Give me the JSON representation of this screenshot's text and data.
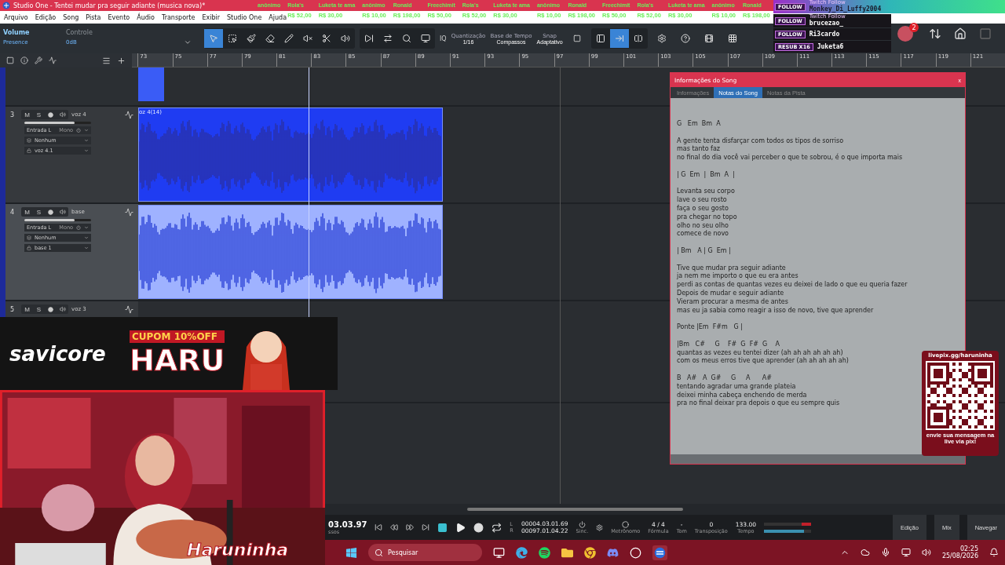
{
  "window": {
    "title": "Studio One - Tentei mudar pra seguir adiante (musica nova)*"
  },
  "menu": [
    "Arquivo",
    "Edição",
    "Song",
    "Pista",
    "Evento",
    "Áudio",
    "Transporte",
    "Exibir",
    "Studio One",
    "Ajuda"
  ],
  "donation_ticker": [
    {
      "name": "anônimo"
    },
    {
      "name": "Rola's",
      "amount": "R$ 52,00"
    },
    {
      "name": "Luketa te ama",
      "amount": "R$ 30,00"
    },
    {
      "name": "anônimo",
      "amount": "R$ 10,00"
    },
    {
      "name": "Ronald",
      "amount": "R$ 198,00"
    },
    {
      "name": "Freechimit",
      "amount": "R$ 50,00"
    },
    {
      "name": "Rola's",
      "amount": "R$ 52,00"
    },
    {
      "name": "Luketa te ama",
      "amount": "R$ 30,00"
    },
    {
      "name": "anônimo",
      "amount": "R$ 10,00"
    },
    {
      "name": "Ronald",
      "amount": "R$ 198,00"
    },
    {
      "name": "Freechimit",
      "amount": "R$ 50,00"
    },
    {
      "name": "Rola's",
      "amount": "R$ 52,00"
    },
    {
      "name": "Luketa te ama",
      "amount": "R$ 30,00"
    },
    {
      "name": "anônimo",
      "amount": "R$ 10,00"
    },
    {
      "name": "Ronald",
      "amount": "R$ 198,00"
    }
  ],
  "follow_alerts": [
    {
      "badge": "FOLLOW",
      "source": "Twitch Follow",
      "user": "Monkey_Di_Luffy2004"
    },
    {
      "badge": "FOLLOW",
      "source": "Twitch Follow",
      "user": "brucezao_"
    },
    {
      "badge": "FOLLOW",
      "user": "Ri3cardo"
    },
    {
      "badge": "RESUB X16",
      "user": "Juketa6"
    }
  ],
  "inspector": {
    "title": "Volume",
    "preset": "Presence",
    "control_label": "Controle",
    "gain": "0dB"
  },
  "edit_tools": [
    {
      "kind": "arrow",
      "selected": true
    },
    {
      "kind": "range",
      "selected": false
    },
    {
      "kind": "paint",
      "selected": false
    },
    {
      "kind": "eraser",
      "selected": false
    },
    {
      "kind": "pencil",
      "selected": false
    },
    {
      "kind": "mute",
      "selected": false
    },
    {
      "kind": "split",
      "selected": false
    },
    {
      "kind": "listen",
      "selected": false
    }
  ],
  "quantize": {
    "iq": "IQ",
    "label": "Quantização",
    "value": "1/16"
  },
  "timebase": {
    "label": "Base de Tempo",
    "value": "Compassos"
  },
  "snap": {
    "label": "Snap",
    "value": "Adaptativo"
  },
  "view_buttons": [
    {
      "kind": "left",
      "selected": false
    },
    {
      "kind": "follow",
      "selected": true
    },
    {
      "kind": "center",
      "selected": false
    }
  ],
  "notifications": "2",
  "ruler": [
    "73",
    "75",
    "77",
    "79",
    "81",
    "83",
    "85",
    "87",
    "89",
    "91",
    "93",
    "95",
    "97",
    "99",
    "101",
    "103",
    "105",
    "107",
    "109",
    "111",
    "113",
    "115",
    "117",
    "119",
    "121"
  ],
  "tracks": [
    {
      "number": "3",
      "name": "voz 4",
      "input": "Entrada L",
      "mode": "Mono",
      "output": "Nenhum",
      "channel": "voz 4.1",
      "mute": "M",
      "solo": "S",
      "selected": false,
      "clip": "oz 4(14)"
    },
    {
      "number": "4",
      "name": "base",
      "input": "Entrada L",
      "mode": "Mono",
      "output": "Nenhum",
      "channel": "base 1",
      "mute": "M",
      "solo": "S",
      "selected": true
    },
    {
      "number": "5",
      "name": "voz 3",
      "mute": "M",
      "solo": "S",
      "selected": false
    }
  ],
  "song_info": {
    "title": "Informações do Song",
    "close": "x",
    "tabs": [
      {
        "label": "Informações",
        "selected": false
      },
      {
        "label": "Notas do Song",
        "selected": true
      },
      {
        "label": "Notas da Pista",
        "selected": false
      }
    ],
    "notes": [
      [
        "G   Em  Bm  A"
      ],
      [
        "A gente tenta disfarçar com todos os tipos de sorriso",
        "mas tanto faz",
        "no final do dia você vai perceber o que te sobrou, é o que importa mais"
      ],
      [
        "| G  Em  |  Bm  A  |"
      ],
      [
        "Levanta seu corpo",
        "lave o seu rosto",
        "faça o seu gosto",
        "pra chegar no topo",
        "olho no seu olho",
        "comece de novo"
      ],
      [
        "| Bm   A | G  Em |"
      ],
      [
        "Tive que mudar pra seguir adiante",
        "ja nem me importo o que eu era antes",
        "perdi as contas de quantas vezes eu deixei de lado o que eu queria fazer",
        "Depois de mudar e seguir adiante",
        "Vieram procurar a mesma de antes",
        "mas eu ja sabia como reagir a isso de novo, tive que aprender"
      ],
      [
        "Ponte |Em  F#m   G |"
      ],
      [
        "|Bm   C#     G    F#  G  F#  G    A",
        "quantas as vezes eu tentei dizer (ah ah ah ah ah ah)",
        "com os meus erros tive que aprender (ah ah ah ah ah)"
      ],
      [
        "B   A#   A  G#     G     A      A#",
        "tentando agradar uma grande plateia",
        "deixei minha cabeça enchendo de merda",
        "pra no final deixar pra depois o que eu sempre quis"
      ]
    ]
  },
  "promo": {
    "brand": "savicore",
    "coupon": "CUPOM 10%OFF",
    "code": "HARU"
  },
  "streamer_logo": "Haruninha",
  "pix": {
    "url": "livepix.gg/haruninha",
    "caption": "envie sua mensagem na live via pix!"
  },
  "transport": {
    "time": "03.03.97",
    "time_unit": "ssos",
    "left_label": "L",
    "right_label": "R",
    "left_time": "00004.03.01.69",
    "right_time": "00097.01.04.22",
    "sync": "Sinc.",
    "metronome": "Metrônomo",
    "signature": "4 / 4",
    "signature_label": "Fórmula",
    "key": "-",
    "key_label": "Tom",
    "transpose": "0",
    "transpose_label": "Transposição",
    "tempo": "133.00",
    "tempo_label": "Tempo",
    "views": [
      "Edição",
      "Mix",
      "Navegar"
    ]
  },
  "taskbar": {
    "search": "Pesquisar",
    "time": "02:25",
    "date": "25/08/2026"
  }
}
